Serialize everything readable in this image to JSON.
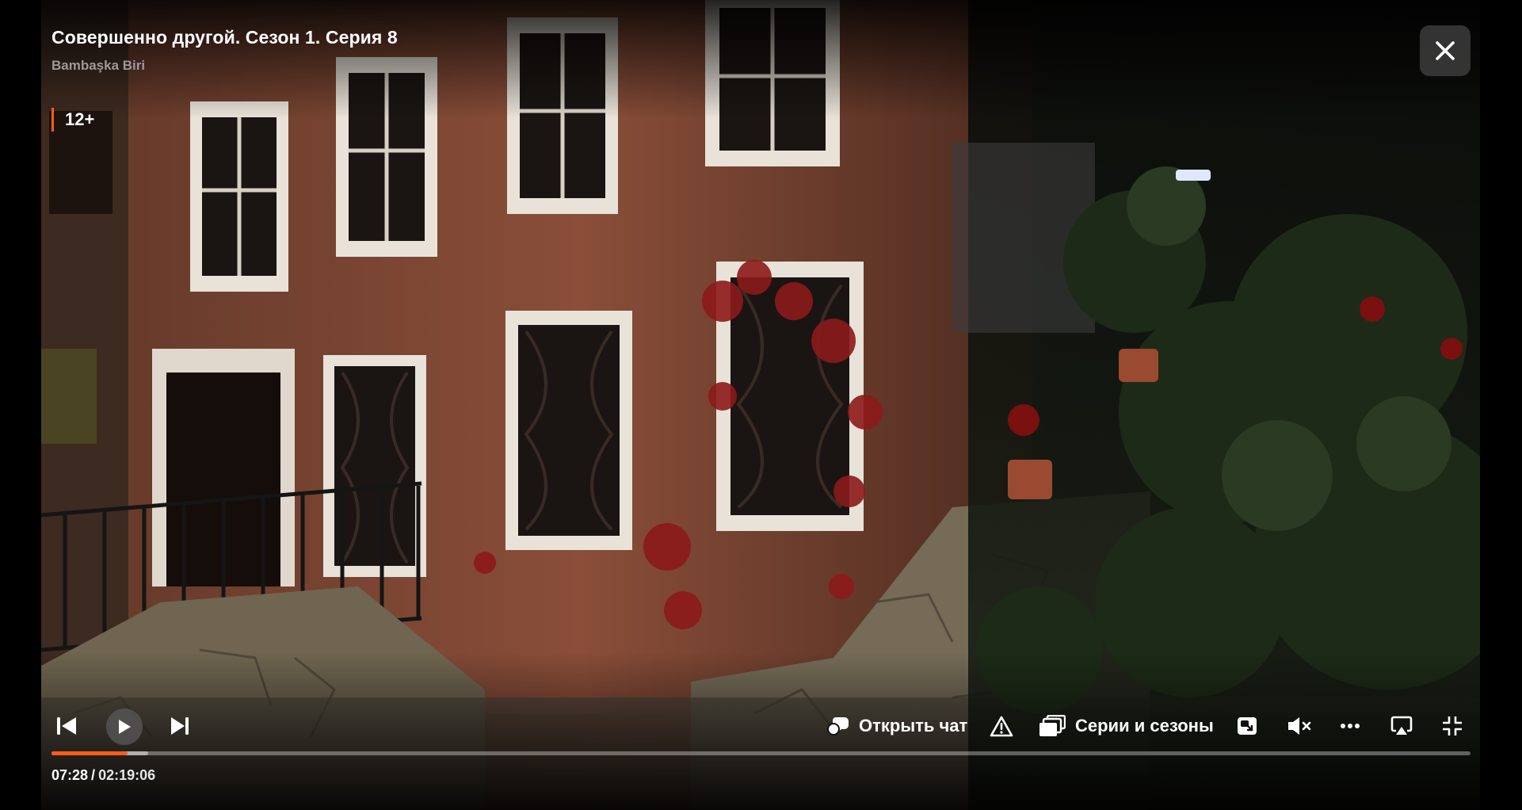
{
  "player": {
    "title": "Совершенно другой. Сезон 1. Серия 8",
    "original_title": "Bambaşka Biri",
    "age_rating": "12+",
    "accent_color": "#ff5c1a",
    "icons": {
      "close": "close-icon",
      "previous": "skip-previous-icon",
      "play": "play-icon",
      "next": "skip-next-icon",
      "chat": "chat-bubble-icon",
      "report": "warning-triangle-icon",
      "seasons": "episodes-stack-icon",
      "pip": "picture-in-picture-icon",
      "volume": "volume-muted-icon",
      "more": "more-horizontal-icon",
      "airplay": "airplay-icon",
      "fullscreen": "exit-fullscreen-icon"
    }
  },
  "controls": {
    "chat_label": "Открыть чат",
    "seasons_label": "Серии и сезоны"
  },
  "playback": {
    "current_time": "07:28",
    "separator": "/",
    "duration": "02:19:06",
    "progress_fraction": 0.0536,
    "buffered_fraction": 0.068
  }
}
